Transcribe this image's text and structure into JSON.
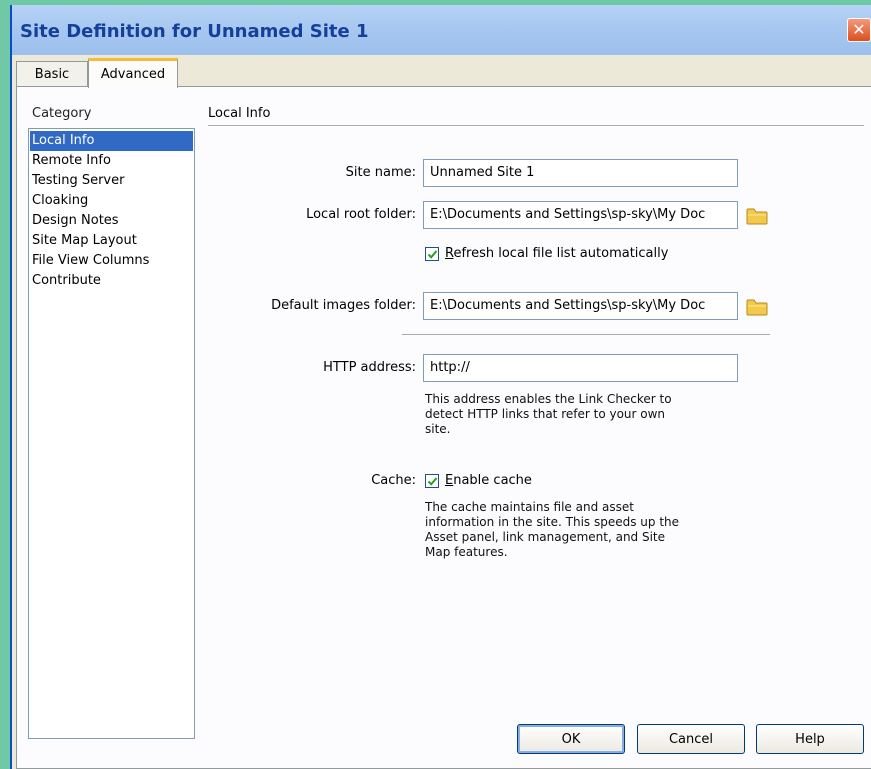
{
  "window": {
    "title": "Site Definition for Unnamed Site 1",
    "close_glyph": "✕"
  },
  "tabs": [
    {
      "label": "Basic"
    },
    {
      "label": "Advanced"
    }
  ],
  "category": {
    "label": "Category",
    "items": [
      "Local Info",
      "Remote Info",
      "Testing Server",
      "Cloaking",
      "Design Notes",
      "Site Map Layout",
      "File View Columns",
      "Contribute"
    ],
    "selected": "Local Info"
  },
  "section": {
    "title": "Local Info"
  },
  "form": {
    "site_name": {
      "label": "Site name:",
      "value": "Unnamed Site 1"
    },
    "local_root": {
      "label": "Local root folder:",
      "value": "E:\\Documents and Settings\\sp-sky\\My Doc"
    },
    "refresh": {
      "label_pre": "",
      "label_mnemonic": "R",
      "label_rest": "efresh local file list automatically",
      "checked": true
    },
    "default_images": {
      "label": "Default images folder:",
      "value": "E:\\Documents and Settings\\sp-sky\\My Doc"
    },
    "http": {
      "label": "HTTP address:",
      "value": "http://",
      "desc": [
        "This address enables the Link Checker to",
        "detect HTTP links that refer to your own",
        "site."
      ]
    },
    "cache": {
      "label": "Cache:",
      "label_mnemonic": "E",
      "label_rest": "nable cache",
      "checked": true,
      "desc": [
        "The cache maintains file and asset",
        "information in the site.  This speeds up the",
        "Asset panel, link management, and Site",
        "Map features."
      ]
    }
  },
  "buttons": {
    "ok": "OK",
    "cancel": "Cancel",
    "help": "Help"
  },
  "colors": {
    "accent": "#316ac5",
    "tab_highlight": "#f7ba3a",
    "folder": "#f3c94b"
  }
}
